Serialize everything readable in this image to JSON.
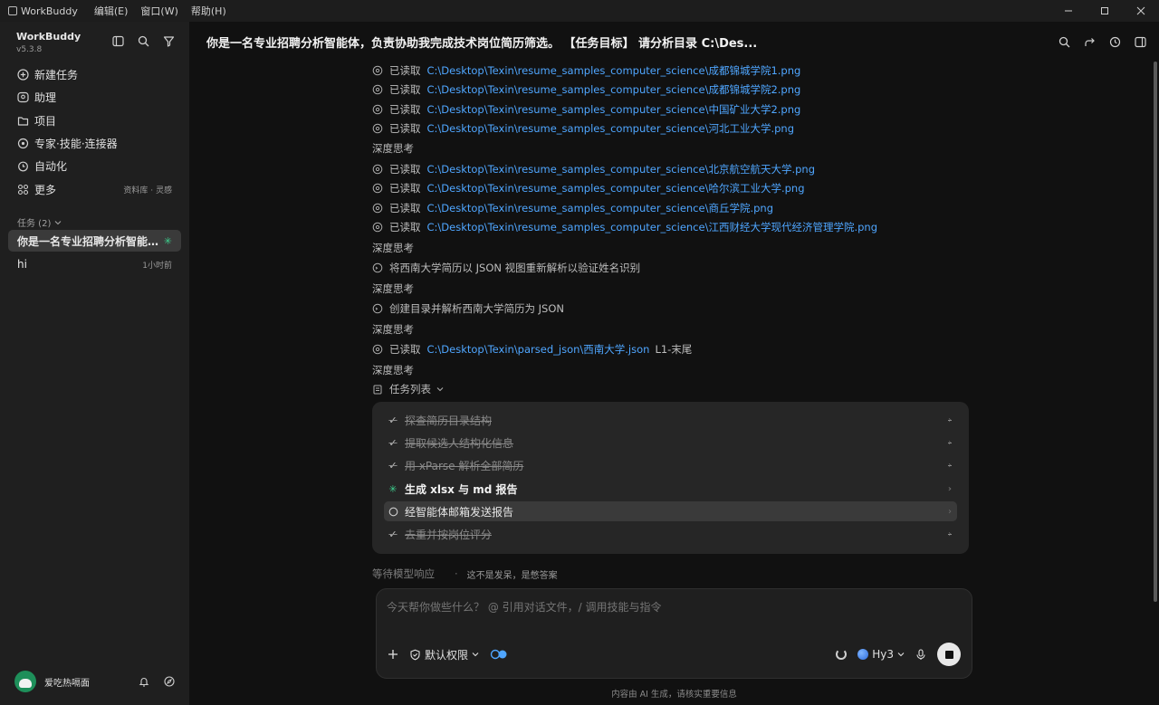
{
  "app": {
    "name": "WorkBuddy",
    "menu": [
      "编辑(E)",
      "窗口(W)",
      "帮助(H)"
    ]
  },
  "sidebar": {
    "title": "WorkBuddy",
    "version": "v5.3.8",
    "nav": [
      {
        "label": "新建任务",
        "icon": "plus-circle-icon"
      },
      {
        "label": "助理",
        "icon": "assistant-icon"
      },
      {
        "label": "项目",
        "icon": "folder-icon"
      },
      {
        "label": "专家·技能·连接器",
        "icon": "expert-icon"
      },
      {
        "label": "自动化",
        "icon": "alarm-clock-icon"
      },
      {
        "label": "更多",
        "icon": "more-grid-icon",
        "extra": "资料库 · 灵感"
      }
    ],
    "tasks_label": "任务 (2)",
    "tasks": [
      {
        "label": "你是一名专业招聘分析智能…",
        "active": true
      },
      {
        "label": "hi",
        "time": "1小时前"
      }
    ],
    "user": {
      "name": "爱吃热嗝面"
    }
  },
  "main": {
    "title": "你是一名专业招聘分析智能体，负责协助我完成技术岗位简历筛选。 【任务目标】 请分析目录 C:\\Des...",
    "log": [
      {
        "kind": "read",
        "label": "已读取",
        "path": "C:\\Desktop\\Texin\\resume_samples_computer_science\\成都锦城学院1.png"
      },
      {
        "kind": "read",
        "label": "已读取",
        "path": "C:\\Desktop\\Texin\\resume_samples_computer_science\\成都锦城学院2.png"
      },
      {
        "kind": "read",
        "label": "已读取",
        "path": "C:\\Desktop\\Texin\\resume_samples_computer_science\\中国矿业大学2.png"
      },
      {
        "kind": "read",
        "label": "已读取",
        "path": "C:\\Desktop\\Texin\\resume_samples_computer_science\\河北工业大学.png"
      },
      {
        "kind": "think",
        "label": "深度思考"
      },
      {
        "kind": "read",
        "label": "已读取",
        "path": "C:\\Desktop\\Texin\\resume_samples_computer_science\\北京航空航天大学.png"
      },
      {
        "kind": "read",
        "label": "已读取",
        "path": "C:\\Desktop\\Texin\\resume_samples_computer_science\\哈尔滨工业大学.png"
      },
      {
        "kind": "read",
        "label": "已读取",
        "path": "C:\\Desktop\\Texin\\resume_samples_computer_science\\商丘学院.png"
      },
      {
        "kind": "read",
        "label": "已读取",
        "path": "C:\\Desktop\\Texin\\resume_samples_computer_science\\江西财经大学现代经济管理学院.png"
      },
      {
        "kind": "think",
        "label": "深度思考"
      },
      {
        "kind": "action",
        "label": "将西南大学简历以 JSON 视图重新解析以验证姓名识别"
      },
      {
        "kind": "think",
        "label": "深度思考"
      },
      {
        "kind": "action",
        "label": "创建目录并解析西南大学简历为 JSON"
      },
      {
        "kind": "think",
        "label": "深度思考"
      },
      {
        "kind": "read",
        "label": "已读取",
        "path": "C:\\Desktop\\Texin\\parsed_json\\西南大学.json",
        "suffix": "L1-末尾"
      },
      {
        "kind": "think",
        "label": "深度思考"
      },
      {
        "kind": "tasklist",
        "label": "任务列表"
      }
    ],
    "tasklist": [
      {
        "label": "探查简历目录结构",
        "state": "done"
      },
      {
        "label": "提取候选人结构化信息",
        "state": "done"
      },
      {
        "label": "用 xParse 解析全部简历",
        "state": "done"
      },
      {
        "label": "生成 xlsx 与 md 报告",
        "state": "active"
      },
      {
        "label": "经智能体邮箱发送报告",
        "state": "pending"
      },
      {
        "label": "去重并按岗位评分",
        "state": "done"
      }
    ],
    "waiting": "等待模型响应",
    "waiting_tip": "这不是发呆，是憋答案",
    "composer": {
      "placeholder": "今天帮你做些什么？ @ 引用对话文件，/ 调用技能与指令",
      "permission": "默认权限",
      "model": "Hy3"
    },
    "footer": "内容由 AI 生成，请核实重要信息"
  },
  "colors": {
    "link": "#4fa6ff",
    "accent": "#3ecf8e",
    "background": "#111111",
    "sidebar": "#1f1f1f"
  }
}
